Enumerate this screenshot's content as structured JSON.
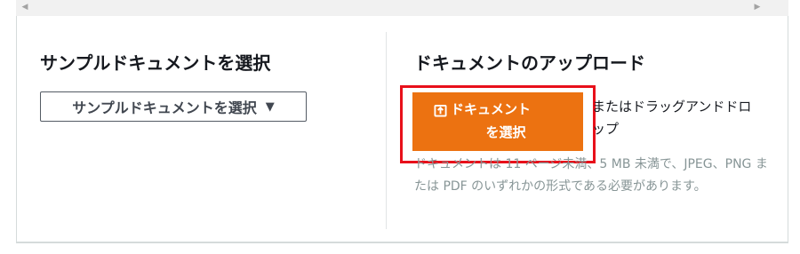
{
  "sample_section": {
    "title": "サンプルドキュメントを選択",
    "dropdown_label": "サンプルドキュメントを選択"
  },
  "upload_section": {
    "title": "ドキュメントのアップロード",
    "button_label_line1": "ドキュメント",
    "button_label_line2": "を選択",
    "drop_text": "またはドラッグアンドドロップ",
    "help_text": "ドキュメントは 11 ページ未満、5 MB 未満で、JPEG、PNG または PDF のいずれかの形式である必要があります。"
  },
  "icons": {
    "scroll_left": "scroll-left-arrow-icon",
    "scroll_right": "scroll-right-arrow-icon",
    "dropdown": "caret-down-icon",
    "upload": "upload-icon"
  },
  "colors": {
    "button_bg": "#ec7211",
    "highlight": "#e8101a",
    "help_text": "#879596"
  }
}
